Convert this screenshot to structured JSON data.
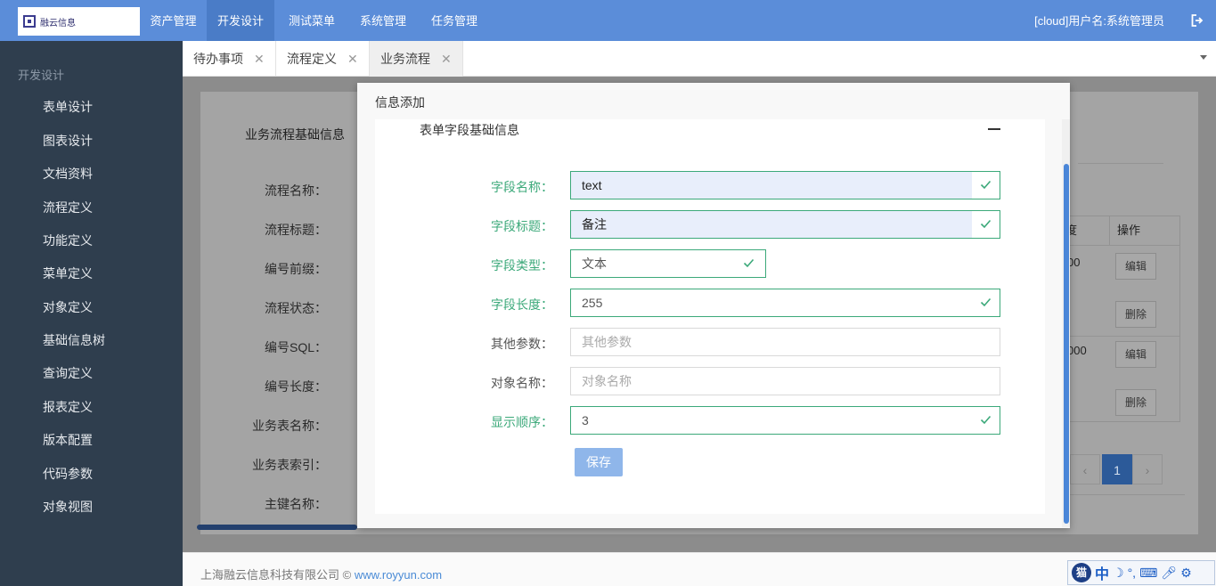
{
  "logo": {
    "text": "融云信息"
  },
  "nav": {
    "items": [
      {
        "label": "资产管理"
      },
      {
        "label": "开发设计"
      },
      {
        "label": "测试菜单"
      },
      {
        "label": "系统管理"
      },
      {
        "label": "任务管理"
      }
    ],
    "active_index": 1,
    "user": "[cloud]用户名:系统管理员",
    "logout_icon": "logout-icon"
  },
  "sidebar": {
    "title": "开发设计",
    "items": [
      {
        "label": "表单设计"
      },
      {
        "label": "图表设计"
      },
      {
        "label": "文档资料"
      },
      {
        "label": "流程定义"
      },
      {
        "label": "功能定义"
      },
      {
        "label": "菜单定义"
      },
      {
        "label": "对象定义"
      },
      {
        "label": "基础信息树"
      },
      {
        "label": "查询定义"
      },
      {
        "label": "报表定义"
      },
      {
        "label": "版本配置"
      },
      {
        "label": "代码参数"
      },
      {
        "label": "对象视图"
      }
    ]
  },
  "tabs": {
    "items": [
      {
        "label": "待办事项",
        "close": "✕"
      },
      {
        "label": "流程定义",
        "close": "✕"
      },
      {
        "label": "业务流程",
        "close": "✕"
      }
    ],
    "active_index": 2
  },
  "background": {
    "panel_title": "业务流程基础信息",
    "labels": [
      "流程名称：",
      "流程标题：",
      "编号前缀：",
      "流程状态：",
      "编号SQL：",
      "编号长度：",
      "业务表名称：",
      "业务表索引：",
      "主键名称："
    ],
    "table": {
      "headers": [
        "度",
        "操作"
      ],
      "rows": [
        {
          "value": "00",
          "edit": "编辑",
          "delete": "删除"
        },
        {
          "value": "000",
          "edit": "编辑",
          "delete": "删除"
        }
      ]
    },
    "pager": {
      "prev": "‹",
      "current": "1",
      "next": "›"
    }
  },
  "modal": {
    "title": "信息添加",
    "section_title": "表单字段基础信息",
    "fields": [
      {
        "label": "字段名称：",
        "value": "text",
        "placeholder": "",
        "valid": true
      },
      {
        "label": "字段标题：",
        "value": "备注",
        "placeholder": "",
        "valid": true
      },
      {
        "label": "字段类型：",
        "value": "文本",
        "placeholder": "",
        "valid": true
      },
      {
        "label": "字段长度：",
        "value": "255",
        "placeholder": "",
        "valid": true
      },
      {
        "label": "其他参数：",
        "value": "",
        "placeholder": "其他参数",
        "valid": false
      },
      {
        "label": "对象名称：",
        "value": "",
        "placeholder": "对象名称",
        "valid": false
      },
      {
        "label": "显示顺序：",
        "value": "3",
        "placeholder": "",
        "valid": true
      }
    ],
    "save_label": "保存"
  },
  "footer": {
    "company": "上海融云信息科技有限公司 © ",
    "link": "www.royyun.com"
  },
  "ime": {
    "logo": "猫",
    "lang": "中",
    "icons": [
      "moon-icon",
      "comma-icon",
      "keyboard-icon",
      "microphone-icon",
      "gear-icon"
    ]
  },
  "colors": {
    "nav": "#5b8dd9",
    "sidebar": "#2f3e4e",
    "valid": "#3ca97a",
    "primary_button": "#8fb6ea"
  }
}
